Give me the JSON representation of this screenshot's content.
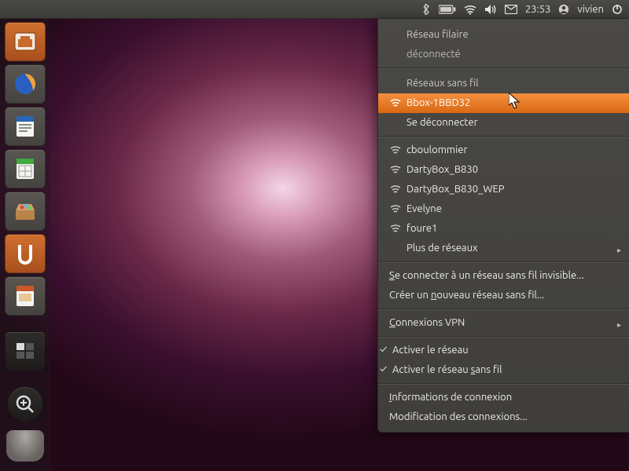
{
  "panel": {
    "time": "23:53",
    "username": "vivien"
  },
  "launcher": {
    "items": [
      {
        "name": "files",
        "color": "orange"
      },
      {
        "name": "firefox"
      },
      {
        "name": "writer"
      },
      {
        "name": "calc"
      },
      {
        "name": "software-center"
      },
      {
        "name": "ubuntu-one",
        "color": "orange"
      },
      {
        "name": "impress"
      }
    ]
  },
  "menu": {
    "wired_header": "Réseau filaire",
    "wired_status": "déconnecté",
    "wireless_header": "Réseaux sans fil",
    "connected_ssid": "Bbox-1BBD32",
    "disconnect": "Se déconnecter",
    "networks": [
      "cboulommier",
      "DartyBox_B830",
      "DartyBox_B830_WEP",
      "Evelyne",
      "foure1"
    ],
    "more_networks": "Plus de réseaux",
    "connect_hidden_pre": "S",
    "connect_hidden": "e connecter à un réseau sans fil invisible...",
    "create_new_pre": "Créer un ",
    "create_new_u": "n",
    "create_new_post": "ouveau réseau sans fil...",
    "vpn_pre": "C",
    "vpn": "onnexions VPN",
    "enable_net": "Activer le réseau",
    "enable_wifi_pre": "Activer le réseau ",
    "enable_wifi_u": "s",
    "enable_wifi_post": "ans fil",
    "conn_info_pre": "I",
    "conn_info": "nformations de connexion",
    "edit_conn": "Modification des connexions..."
  }
}
